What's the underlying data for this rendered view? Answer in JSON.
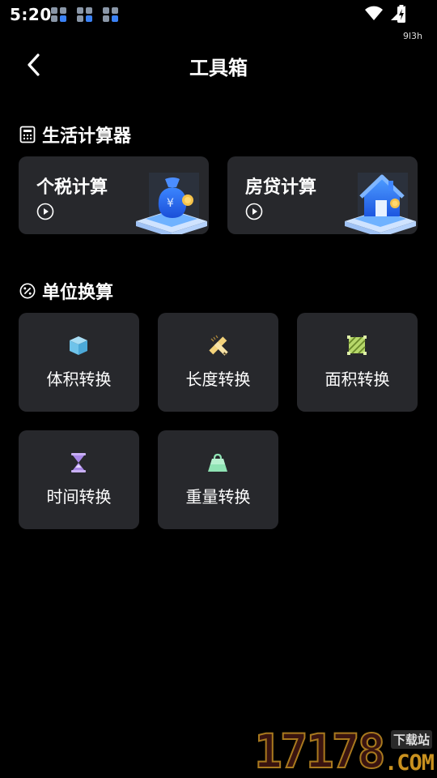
{
  "status_bar": {
    "time": "5:20",
    "net_speed": "9l3h",
    "icons": [
      "app-notification-icon",
      "wifi-icon",
      "cellular-signal-icon",
      "battery-charging-icon"
    ]
  },
  "header": {
    "title": "工具箱",
    "back_icon": "chevron-left-icon"
  },
  "life_calculators": {
    "title": "生活计算器",
    "icon": "calculator-icon",
    "items": [
      {
        "label": "个税计算",
        "icon": "money-bag-icon"
      },
      {
        "label": "房贷计算",
        "icon": "house-icon"
      }
    ]
  },
  "unit_conversion": {
    "title": "单位换算",
    "icon": "percent-circle-icon",
    "items": [
      {
        "label": "体积转换",
        "icon": "cube-icon",
        "color": "#6fc3ea"
      },
      {
        "label": "长度转换",
        "icon": "pencil-ruler-icon",
        "color": "#f3d27a"
      },
      {
        "label": "面积转换",
        "icon": "area-square-icon",
        "color": "#b7d86a"
      },
      {
        "label": "时间转换",
        "icon": "hourglass-icon",
        "color": "#a987e8"
      },
      {
        "label": "重量转换",
        "icon": "weight-bag-icon",
        "color": "#8fe3b4"
      }
    ]
  },
  "watermark": {
    "number": "17178",
    "tag": "下载站",
    "domain": ".COM"
  },
  "colors": {
    "background": "#000000",
    "card": "#27282c",
    "text": "#ffffff"
  }
}
